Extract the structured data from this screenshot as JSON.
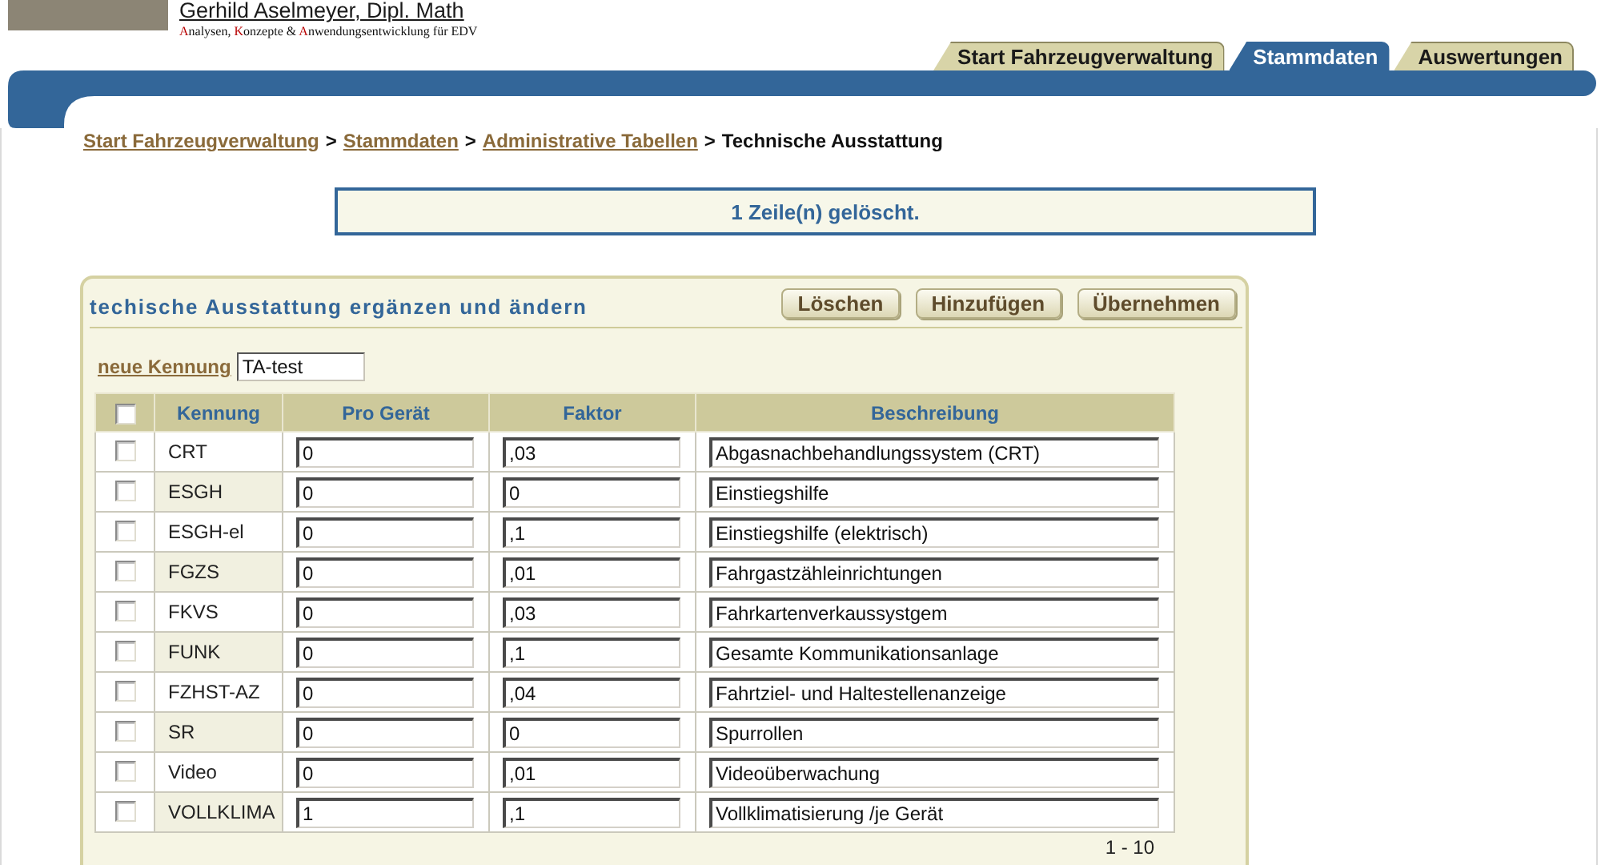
{
  "header": {
    "name": "Gerhild Aselmeyer, Dipl. Math",
    "tagline": [
      {
        "text": "A",
        "highlight": true
      },
      {
        "text": "nalysen, ",
        "highlight": false
      },
      {
        "text": "K",
        "highlight": true
      },
      {
        "text": "onzepte & ",
        "highlight": false
      },
      {
        "text": "A",
        "highlight": true
      },
      {
        "text": "nwendungsentwicklung für EDV",
        "highlight": false
      }
    ]
  },
  "tabs": [
    {
      "label": "Start Fahrzeugverwaltung",
      "selected": false
    },
    {
      "label": "Stammdaten",
      "selected": true
    },
    {
      "label": "Auswertungen",
      "selected": false
    }
  ],
  "breadcrumb": [
    {
      "kind": "link",
      "text": "Start Fahrzeugverwaltung"
    },
    {
      "kind": "separator",
      "text": ">"
    },
    {
      "kind": "link",
      "text": "Stammdaten"
    },
    {
      "kind": "separator",
      "text": ">"
    },
    {
      "kind": "link",
      "text": "Administrative Tabellen"
    },
    {
      "kind": "separator",
      "text": ">"
    },
    {
      "kind": "current",
      "text": "Technische Ausstattung"
    }
  ],
  "message": "1 Zeile(n) gelöscht.",
  "panel": {
    "title": "techische Ausstattung ergänzen und ändern",
    "buttons": [
      "Löschen",
      "Hinzufügen",
      "Übernehmen"
    ],
    "new_key": {
      "label": "neue Kennung",
      "value": "TA-test"
    },
    "table": {
      "select_all": {
        "checked": false
      },
      "columns": [
        "Kennung",
        "Pro Gerät",
        "Faktor",
        "Beschreibung"
      ],
      "rows": [
        {
          "checked": false,
          "code": "CRT",
          "per_device": "0",
          "factor": ",03",
          "description": "Abgasnachbehandlungssystem (CRT)"
        },
        {
          "checked": false,
          "code": "ESGH",
          "per_device": "0",
          "factor": "0",
          "description": "Einstiegshilfe"
        },
        {
          "checked": false,
          "code": "ESGH-el",
          "per_device": "0",
          "factor": ",1",
          "description": "Einstiegshilfe (elektrisch)"
        },
        {
          "checked": false,
          "code": "FGZS",
          "per_device": "0",
          "factor": ",01",
          "description": "Fahrgastzähleinrichtungen"
        },
        {
          "checked": false,
          "code": "FKVS",
          "per_device": "0",
          "factor": ",03",
          "description": "Fahrkartenverkaussystgem"
        },
        {
          "checked": false,
          "code": "FUNK",
          "per_device": "0",
          "factor": ",1",
          "description": "Gesamte Kommunikationsanlage"
        },
        {
          "checked": false,
          "code": "FZHST-AZ",
          "per_device": "0",
          "factor": ",04",
          "description": "Fahrtziel- und Haltestellenanzeige"
        },
        {
          "checked": false,
          "code": "SR",
          "per_device": "0",
          "factor": "0",
          "description": "Spurrollen"
        },
        {
          "checked": false,
          "code": "Video",
          "per_device": "0",
          "factor": ",01",
          "description": "Videoüberwachung"
        },
        {
          "checked": false,
          "code": "VOLLKLIMA",
          "per_device": "1",
          "factor": ",1",
          "description": "Vollklimatisierung /je Gerät"
        }
      ]
    },
    "pagination": "1 - 10"
  }
}
